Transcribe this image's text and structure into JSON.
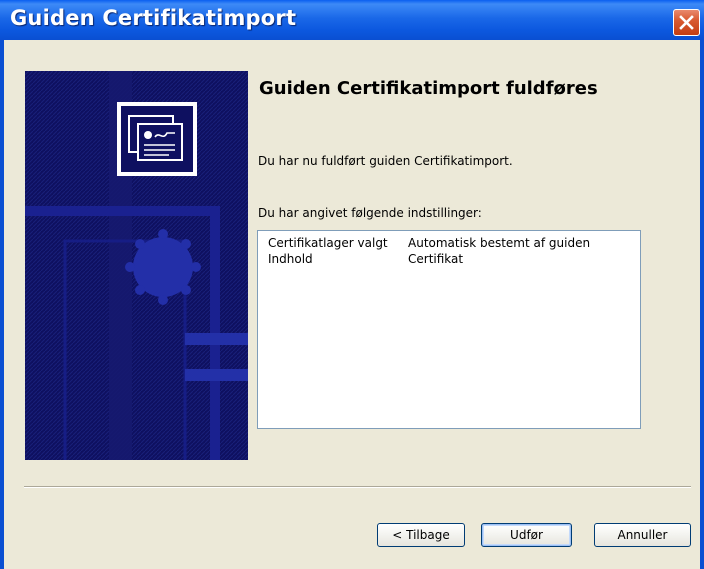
{
  "window": {
    "title": "Guiden Certifikatimport"
  },
  "colors": {
    "titlebar": "#0a5ff0",
    "client_bg": "#ece9d8",
    "banner_bg": "#0e1060",
    "close_button": "#d95b32"
  },
  "content": {
    "heading": "Guiden Certifikatimport fuldføres",
    "completed_text": "Du har nu fuldført guiden Certifikatimport.",
    "settings_intro": "Du har angivet følgende indstillinger:",
    "settings": [
      {
        "name": "Certifikatlager valgt",
        "value": "Automatisk bestemt af guiden"
      },
      {
        "name": "Indhold",
        "value": "Certifikat"
      }
    ]
  },
  "buttons": {
    "back": "< Tilbage",
    "finish": "Udfør",
    "cancel": "Annuller"
  },
  "icons": {
    "close": "close-icon",
    "banner": "certificate-icon"
  }
}
